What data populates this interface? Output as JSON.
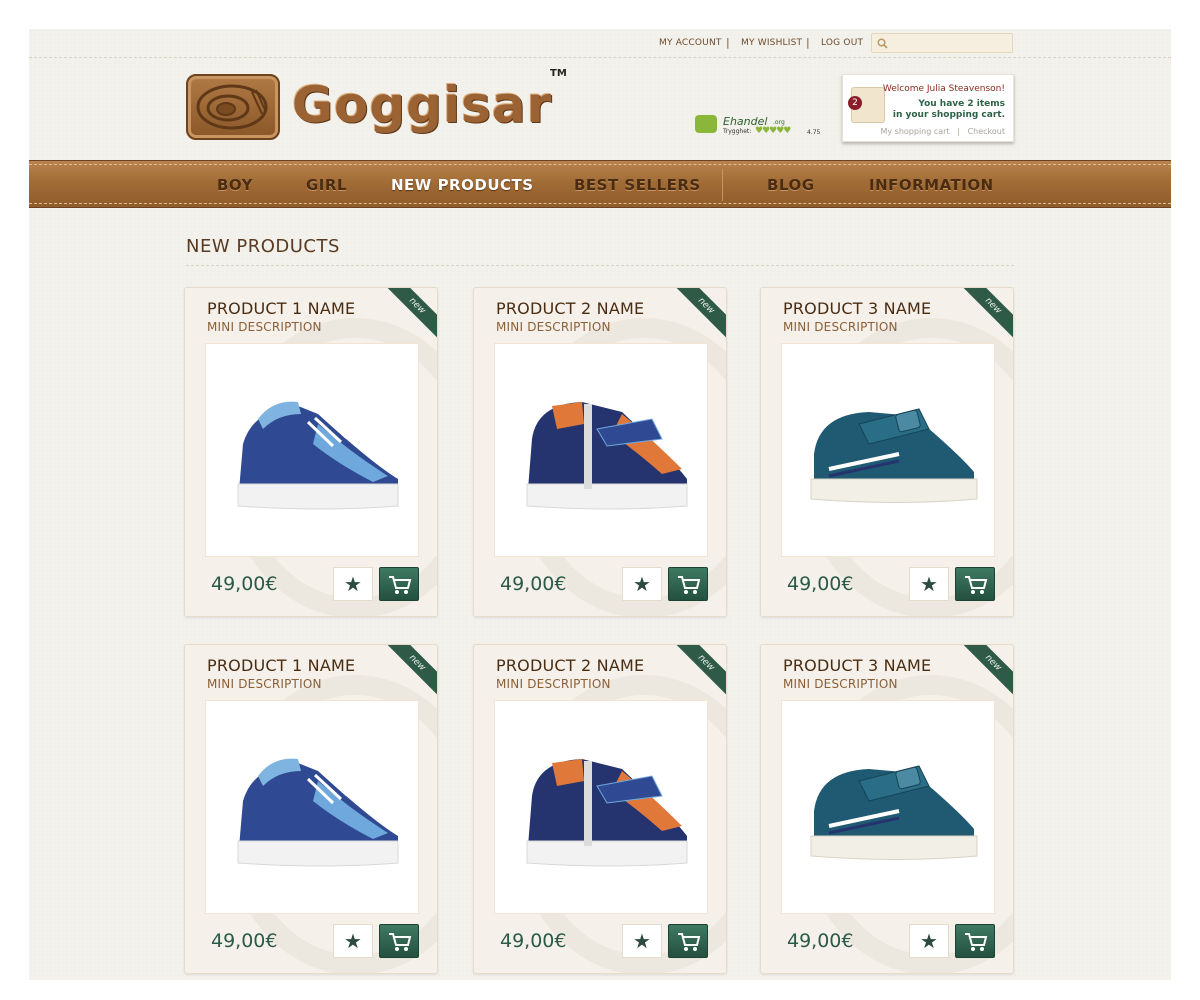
{
  "topbar": {
    "links": [
      "MY ACCOUNT",
      "MY WISHLIST",
      "LOG OUT"
    ],
    "separator": "|",
    "search": {
      "value": "",
      "icon": "search-icon"
    }
  },
  "header": {
    "logo_text": "Goggisar",
    "logo_tm": "TM",
    "ehandel": {
      "name": "Ehandel",
      "org": ".org",
      "label": "Trygghet:",
      "score": "4.75"
    },
    "cart": {
      "count": "2",
      "welcome": "Welcome Julia Steavenson!",
      "line1": "You have 2 items",
      "line2": "in your shopping cart.",
      "link_cart": "My shopping cart",
      "link_sep": "|",
      "link_checkout": "Checkout"
    }
  },
  "nav": {
    "items": [
      "BOY",
      "GIRL",
      "NEW PRODUCTS",
      "BEST SELLERS",
      "BLOG",
      "INFORMATION"
    ],
    "active": "NEW PRODUCTS"
  },
  "section": {
    "title": "NEW PRODUCTS"
  },
  "products": [
    {
      "name": "PRODUCT 1 NAME",
      "desc": "MINI DESCRIPTION",
      "price": "49,00€",
      "badge": "new",
      "shoe": "blue-lace-sneaker"
    },
    {
      "name": "PRODUCT 2 NAME",
      "desc": "MINI DESCRIPTION",
      "price": "49,00€",
      "badge": "new",
      "shoe": "navy-orange-zip-boot"
    },
    {
      "name": "PRODUCT 3 NAME",
      "desc": "MINI DESCRIPTION",
      "price": "49,00€",
      "badge": "new",
      "shoe": "teal-velcro-shoe"
    },
    {
      "name": "PRODUCT 1 NAME",
      "desc": "MINI DESCRIPTION",
      "price": "49,00€",
      "badge": "new",
      "shoe": "blue-lace-sneaker"
    },
    {
      "name": "PRODUCT 2 NAME",
      "desc": "MINI DESCRIPTION",
      "price": "49,00€",
      "badge": "new",
      "shoe": "navy-orange-zip-boot"
    },
    {
      "name": "PRODUCT 3 NAME",
      "desc": "MINI DESCRIPTION",
      "price": "49,00€",
      "badge": "new",
      "shoe": "teal-velcro-shoe"
    }
  ],
  "colors": {
    "brand_brown": "#9b6334",
    "accent_green": "#2c5a48",
    "background": "#f3f1ec"
  }
}
